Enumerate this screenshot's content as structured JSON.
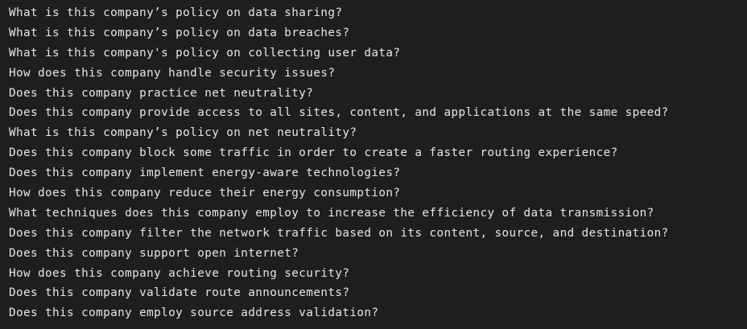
{
  "lines": [
    "What is this company’s policy on data sharing?",
    "What is this company’s policy on data breaches?",
    "What is this company's policy on collecting user data?",
    "How does this company handle security issues?",
    "Does this company practice net neutrality?",
    "Does this company provide access to all sites, content, and applications at the same speed?",
    "What is this company’s policy on net neutrality?",
    "Does this company block some traffic in order to create a faster routing experience?",
    "Does this company implement energy-aware technologies?",
    "How does this company reduce their energy consumption?",
    "What techniques does this company employ to increase the efficiency of data transmission?",
    "Does this company filter the network traffic based on its content, source, and destination?",
    "Does this company support open internet?",
    "How does this company achieve routing security?",
    "Does this company validate route announcements?",
    "Does this company employ source address validation?"
  ]
}
